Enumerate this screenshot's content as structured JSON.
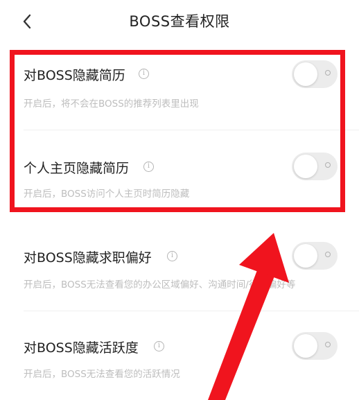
{
  "header": {
    "title": "BOSS查看权限",
    "back_icon": "chevron-left-icon"
  },
  "settings": [
    {
      "title": "对BOSS隐藏简历",
      "description": "开启后，将不会在BOSS的推荐列表里出现",
      "enabled": false
    },
    {
      "title": "个人主页隐藏简历",
      "description": "开启后，BOSS访问个人主页时简历隐藏",
      "enabled": false
    },
    {
      "title": "对BOSS隐藏求职偏好",
      "description": "开启后，BOSS无法查看您的办公区域偏好、沟通时间/行为偏好等",
      "enabled": false
    },
    {
      "title": "对BOSS隐藏活跃度",
      "description": "开启后，BOSS无法查看您的活跃情况",
      "enabled": false
    }
  ],
  "info_icon_glyph": "i",
  "colors": {
    "highlight": "#f0141e",
    "toggle_track_off": "#ececec",
    "title_text": "#222222",
    "description_text": "#bdbdbd"
  }
}
